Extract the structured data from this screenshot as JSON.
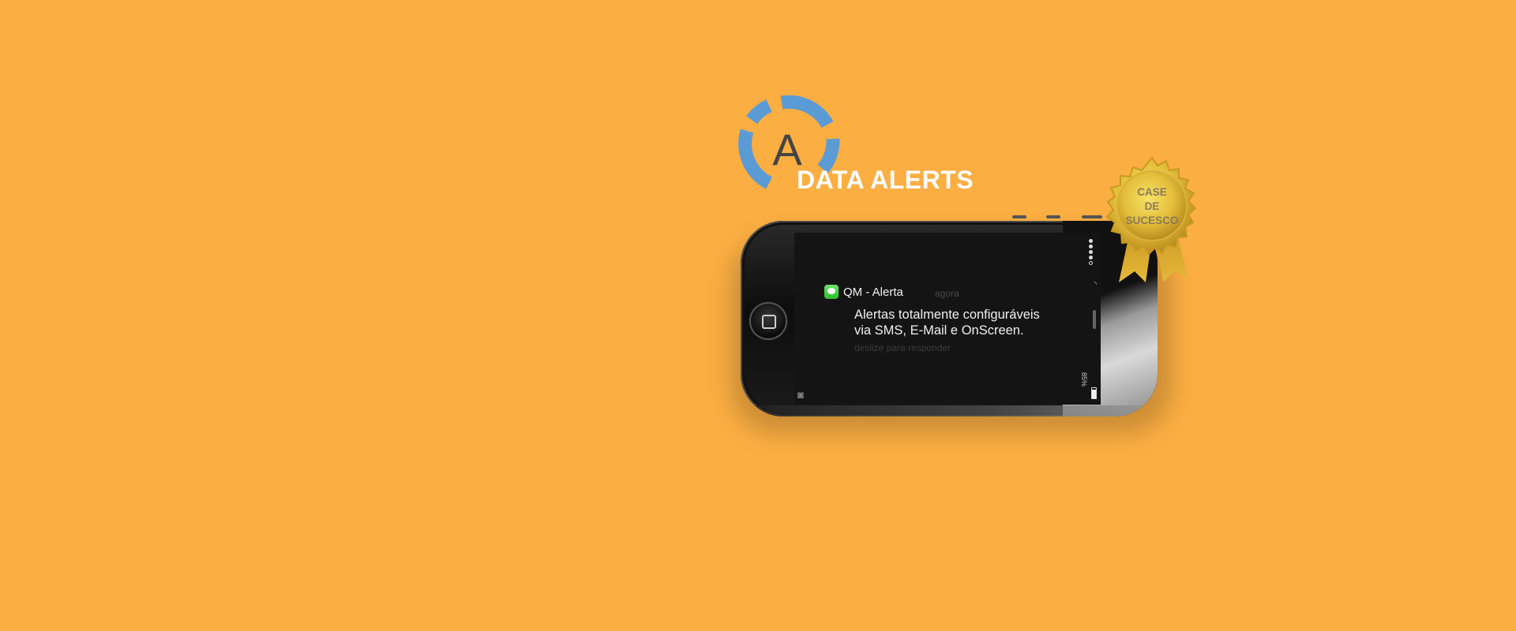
{
  "logo": {
    "letter": "A",
    "text": "DATA ALERTS",
    "ring_color": "#5B9BD5"
  },
  "notification": {
    "app_icon": "messages-icon",
    "app_name": "QM - Alerta",
    "time": "agora",
    "message_line1": "Alertas totalmente configuráveis",
    "message_line2": "via SMS, E-Mail e OnScreen.",
    "hint": "deslize para responder"
  },
  "status_bar": {
    "battery": "85%"
  },
  "badge": {
    "line1": "CASE",
    "line2": "DE",
    "line3": "SUCESCO",
    "color": "#E8C547"
  },
  "colors": {
    "background": "#FBAE42",
    "screen": "#141414"
  }
}
